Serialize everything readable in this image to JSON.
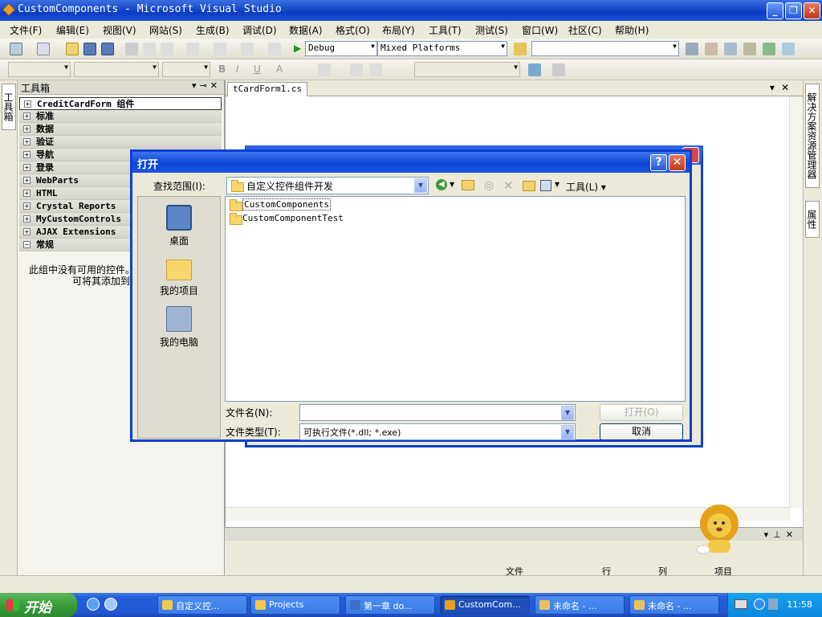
{
  "window": {
    "title": "CustomComponents - Microsoft Visual Studio"
  },
  "menu": [
    "文件(F)",
    "编辑(E)",
    "视图(V)",
    "网站(S)",
    "生成(B)",
    "调试(D)",
    "数据(A)",
    "格式(O)",
    "布局(Y)",
    "工具(T)",
    "测试(S)",
    "窗口(W)",
    "社区(C)",
    "帮助(H)"
  ],
  "toolbar": {
    "config": "Debug",
    "platform": "Mixed Platforms"
  },
  "left_tabs": [
    "工具箱"
  ],
  "toolbox": {
    "title": "工具箱",
    "groups": [
      "CreditCardForm 组件",
      "标准",
      "数据",
      "验证",
      "导航",
      "登录",
      "WebParts",
      "HTML",
      "Crystal Reports",
      "MyCustomControls",
      "AJAX Extensions",
      "常规"
    ],
    "empty_line1": "此组中没有可用的控件。",
    "empty_line2": "可将其添加到"
  },
  "document": {
    "tab": "tCardForm1.cs"
  },
  "right_tabs": [
    "解决方案资源管理器",
    "属性"
  ],
  "bottom_panel": {
    "columns": [
      "文件",
      "行",
      "列",
      "项目"
    ]
  },
  "dialog": {
    "title": "打开",
    "lookin_label": "查找范围(I):",
    "lookin_value": "自定义控件组件开发",
    "tools_label": "工具(L)",
    "places": [
      "桌面",
      "我的项目",
      "我的电脑"
    ],
    "files": [
      "CustomComponents",
      "CustomComponentTest"
    ],
    "filename_label": "文件名(N):",
    "filename_value": "",
    "filetype_label": "文件类型(T):",
    "filetype_value": "可执行文件(*.dll; *.exe)",
    "open_button": "打开(O)",
    "cancel_button": "取消"
  },
  "taskbar": {
    "start": "开始",
    "buttons": [
      "自定义控...",
      "Projects",
      "第一章 do...",
      "CustomCom...",
      "未命名 - ...",
      "未命名 - ..."
    ],
    "clock": "11:58"
  },
  "colors": {
    "title_blue": "#0a3cc2",
    "taskbar_blue": "#245dd7",
    "start_green": "#3a9c3a"
  }
}
